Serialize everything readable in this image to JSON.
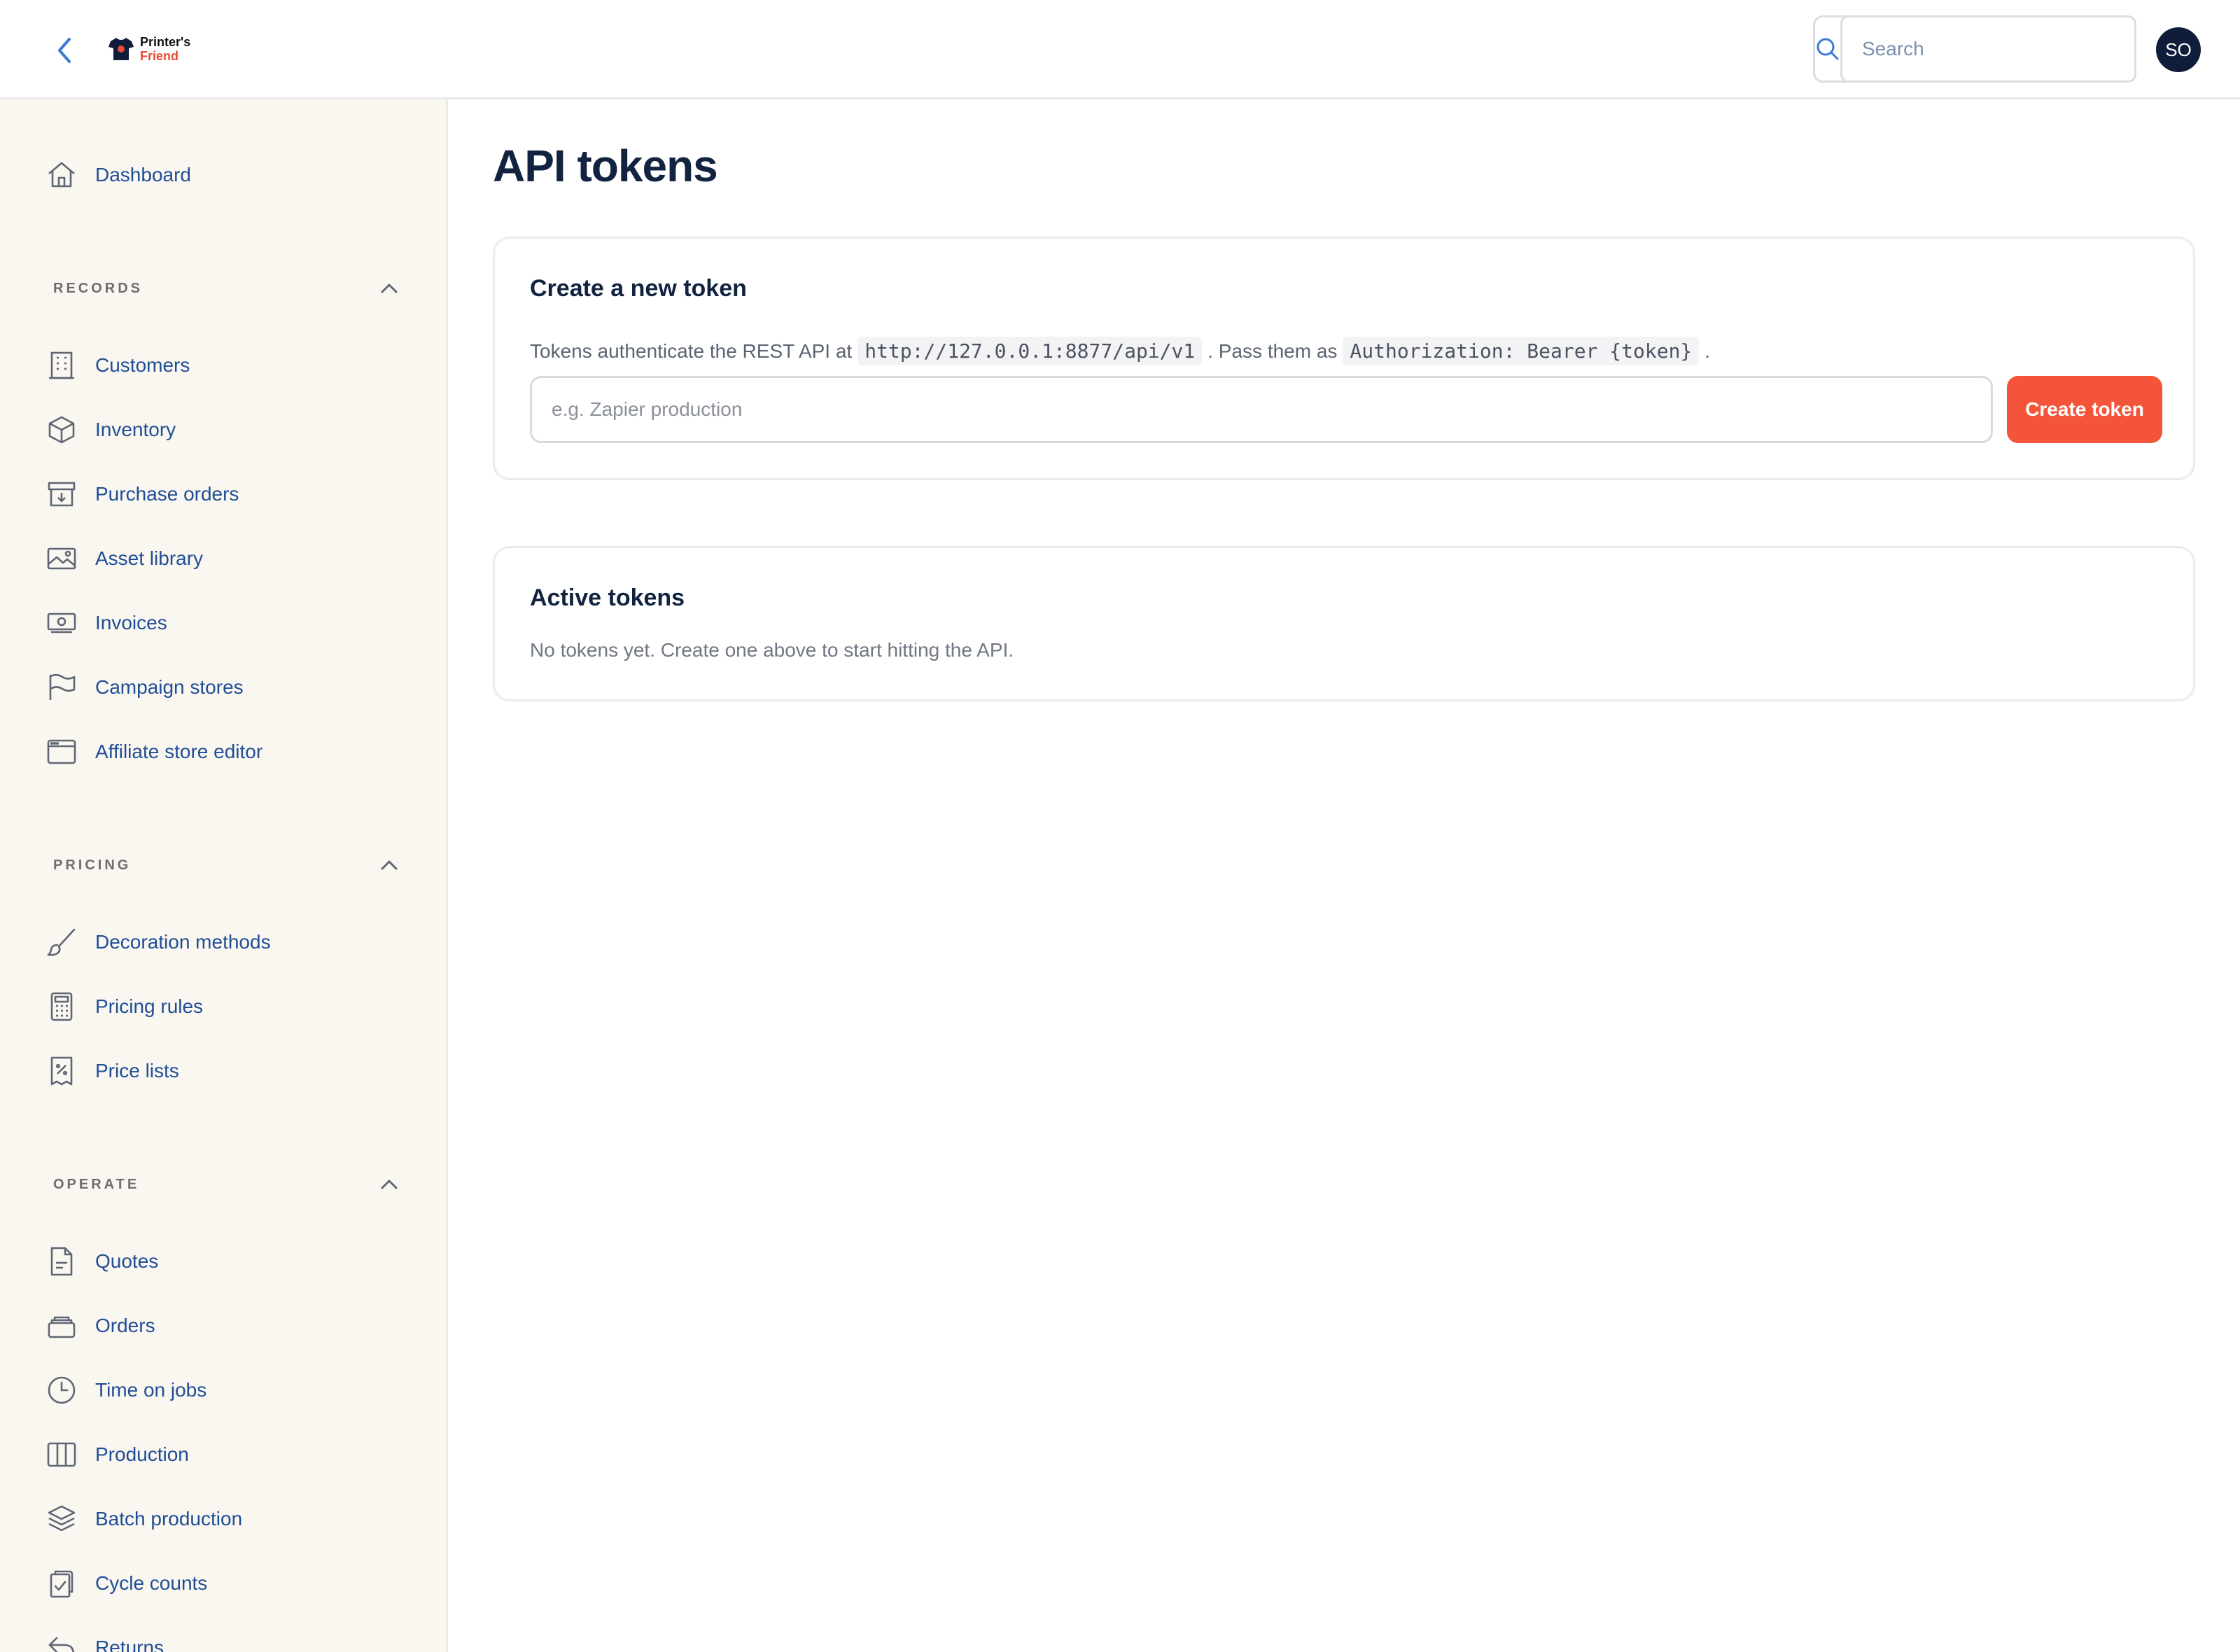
{
  "brand": {
    "line1": "Printer's",
    "line2": "Friend"
  },
  "search": {
    "placeholder": "Search"
  },
  "user": {
    "initials": "SO"
  },
  "sidebar": {
    "dashboard": "Dashboard",
    "sections": [
      {
        "title": "RECORDS",
        "items": [
          "Customers",
          "Inventory",
          "Purchase orders",
          "Asset library",
          "Invoices",
          "Campaign stores",
          "Affiliate store editor"
        ]
      },
      {
        "title": "PRICING",
        "items": [
          "Decoration methods",
          "Pricing rules",
          "Price lists"
        ]
      },
      {
        "title": "OPERATE",
        "items": [
          "Quotes",
          "Orders",
          "Time on jobs",
          "Production",
          "Batch production",
          "Cycle counts",
          "Returns"
        ]
      }
    ]
  },
  "page": {
    "title": "API tokens"
  },
  "create_card": {
    "title": "Create a new token",
    "desc_prefix": "Tokens authenticate the REST API at",
    "api_url": "http://127.0.0.1:8877/api/v1",
    "desc_middle": ". Pass them as",
    "auth_header": "Authorization: Bearer {token}",
    "desc_suffix": ".",
    "input_placeholder": "e.g. Zapier production",
    "button_label": "Create token"
  },
  "active_card": {
    "title": "Active tokens",
    "empty_message": "No tokens yet. Create one above to start hitting the API."
  },
  "colors": {
    "accent": "#f4553a",
    "nav_text": "#1f4e96",
    "sidebar_bg": "#faf6f0",
    "heading": "#12233f",
    "avatar_bg": "#0f1d3a"
  }
}
